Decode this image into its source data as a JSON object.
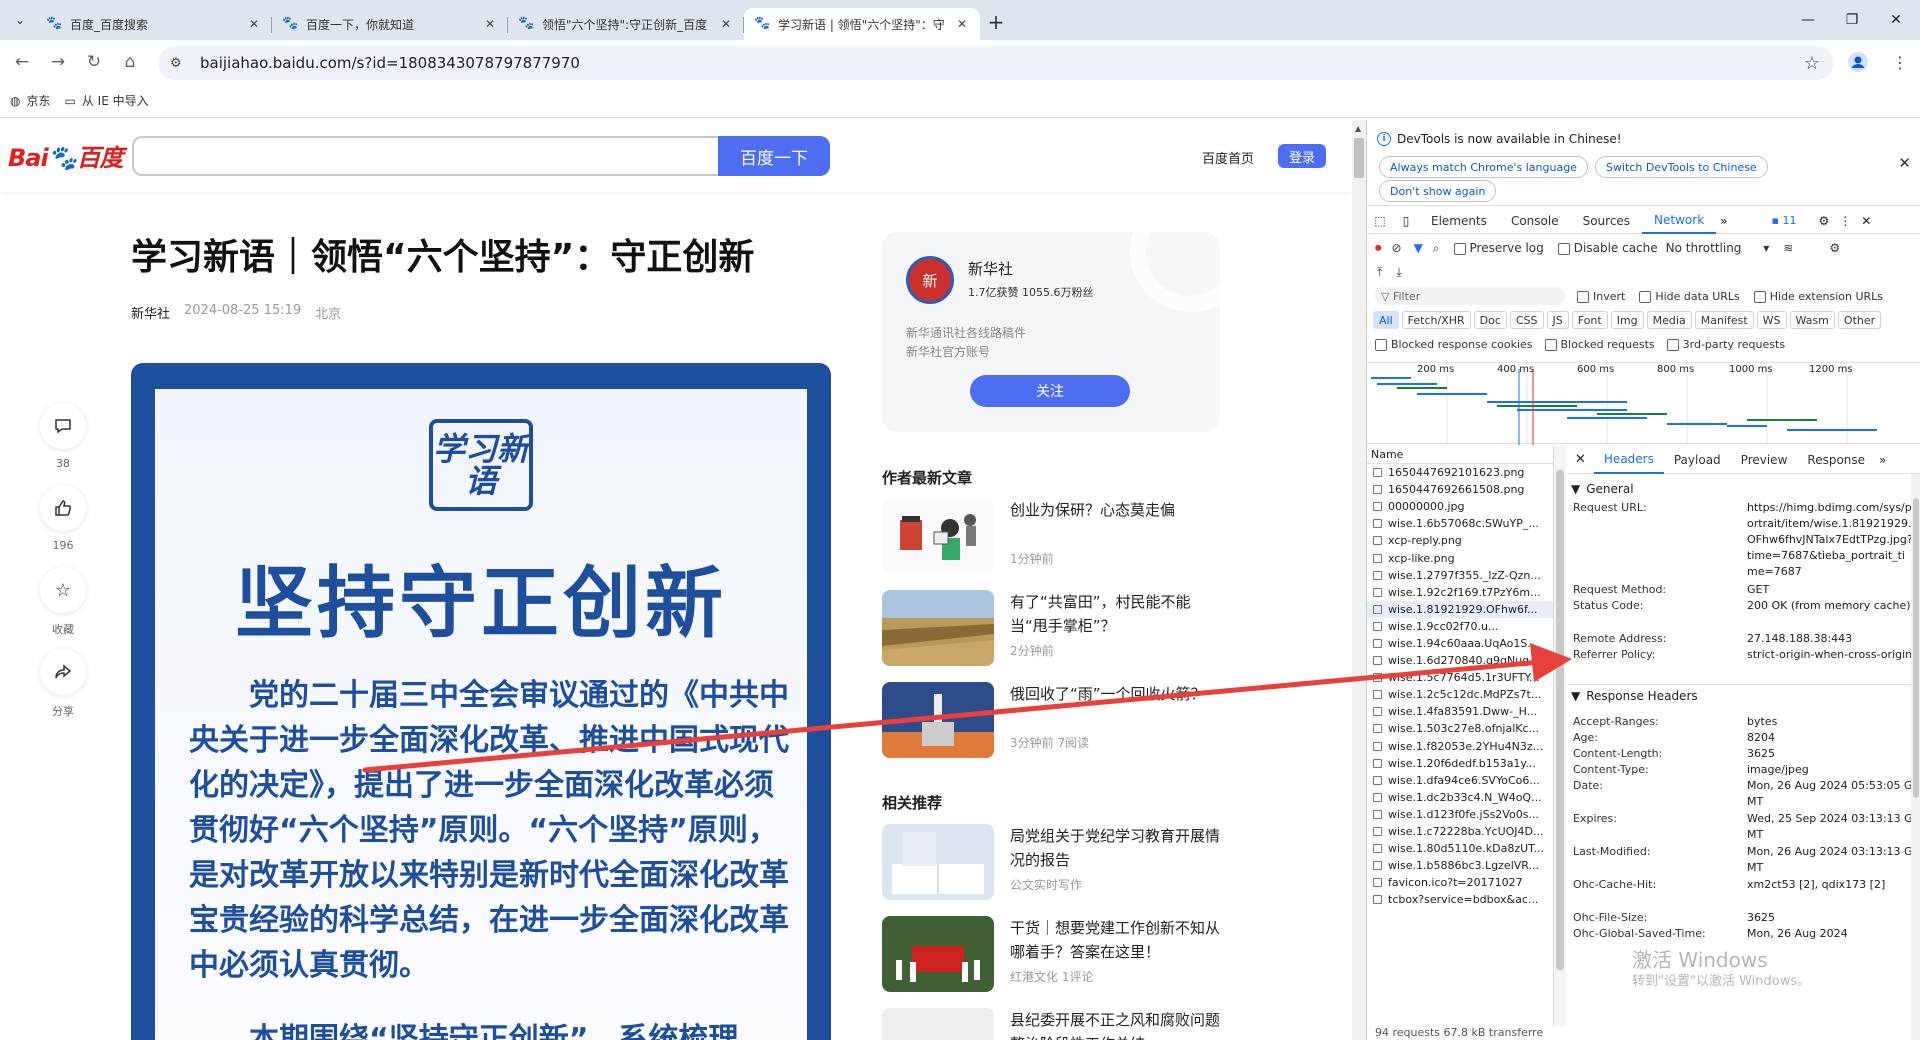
{
  "browser": {
    "tabs": [
      {
        "title": "百度_百度搜索"
      },
      {
        "title": "百度一下，你就知道"
      },
      {
        "title": "领悟\"六个坚持\":守正创新_百度"
      },
      {
        "title": "学习新语 | 领悟\"六个坚持\"：守"
      }
    ],
    "url": "baijiahao.baidu.com/s?id=1808343078797877970",
    "bookmarks": [
      "京东",
      "从 IE 中导入"
    ]
  },
  "baidu_header": {
    "logo_left": "Bai",
    "logo_paw": "du",
    "logo_right": "百度",
    "search_button": "百度一下",
    "home_link": "百度首页",
    "login": "登录"
  },
  "article": {
    "title": "学习新语｜领悟“六个坚持”：守正创新",
    "source": "新华社",
    "datetime": "2024-08-25 15:19",
    "location": "北京",
    "poster": {
      "logo_text": "学习新语",
      "headline": "坚持守正创新",
      "para1": "党的二十届三中全会审议通过的《中共中央关于进一步全面深化改革、推进中国式现代化的决定》，提出了进一步全面深化改革必须贯彻好“六个坚持”原则。“六个坚持”原则，是对改革开放以来特别是新时代全面深化改革宝贵经验的科学总结，在进一步全面深化改革中必须认真贯彻。",
      "para2": "本期围绕“坚持守正创新”，系统梳理"
    }
  },
  "side_actions": [
    {
      "icon": "comment-icon",
      "label": "38"
    },
    {
      "icon": "thumbs-up-icon",
      "label": "196"
    },
    {
      "icon": "star-icon",
      "label": "收藏"
    },
    {
      "icon": "share-icon",
      "label": "分享"
    }
  ],
  "author": {
    "name": "新华社",
    "stats": "1.7亿获赞 1055.6万粉丝",
    "desc1": "新华通讯社各线路稿件",
    "desc2": "新华社官方账号",
    "follow": "关注",
    "avatar_text": "新"
  },
  "latest": {
    "title": "作者最新文章",
    "items": [
      {
        "title": "创业为保研？心态莫走偏",
        "meta": "1分钟前"
      },
      {
        "title": "有了“共富田”，村民能不能当“甩手掌柜”？",
        "meta": "2分钟前"
      },
      {
        "title": "俄回收了“雨”一个回收火箭？",
        "meta": "3分钟前 7阅读"
      }
    ]
  },
  "related": {
    "title": "相关推荐",
    "items": [
      {
        "title": "局党组关于党纪学习教育开展情况的报告",
        "meta": "公文实时写作"
      },
      {
        "title": "干货｜想要党建工作创新不知从哪着手？答案在这里！",
        "meta": "红港文化 1评论"
      },
      {
        "title": "县纪委开展不正之风和腐败问题整治阶段性工作总结",
        "meta": ""
      }
    ]
  },
  "devtools": {
    "banner_text": "DevTools is now available in Chinese!",
    "btn_match": "Always match Chrome's language",
    "btn_switch": "Switch DevTools to Chinese",
    "btn_dont": "Don't show again",
    "tabs": [
      "Elements",
      "Console",
      "Sources",
      "Network"
    ],
    "issues_count": "11",
    "preserve_log": "Preserve log",
    "disable_cache": "Disable cache",
    "throttling": "No throttling",
    "filter_placeholder": "Filter",
    "invert": "Invert",
    "hide_data_urls": "Hide data URLs",
    "hide_ext_urls": "Hide extension URLs",
    "filter_types": [
      "All",
      "Fetch/XHR",
      "Doc",
      "CSS",
      "JS",
      "Font",
      "Img",
      "Media",
      "Manifest",
      "WS",
      "Wasm",
      "Other"
    ],
    "blocked_cookies": "Blocked response cookies",
    "blocked_requests": "Blocked requests",
    "third_party": "3rd-party requests",
    "timeline_ticks": [
      "200 ms",
      "400 ms",
      "600 ms",
      "800 ms",
      "1000 ms",
      "1200 ms"
    ],
    "name_col": "Name",
    "requests": [
      "1650447692101623.png",
      "1650447692661508.png",
      "00000000.jpg",
      "wise.1.6b57068c.SWuYP_...",
      "xcp-reply.png",
      "xcp-like.png",
      "wise.1.2797f355._lzZ-Qzn...",
      "wise.1.92c2f169.t7PzY6m...",
      "wise.1.81921929.OFhw6f...",
      "wise.1.9cc02f70.u...",
      "wise.1.94c60aaa.UqAo1S...",
      "wise.1.6d270840.q9gNuq...",
      "wise.1.5c7764d5.1r3UFTY...",
      "wise.1.2c5c12dc.MdPZs7t...",
      "wise.1.4fa83591.Dww-_H...",
      "wise.1.503c27e8.ofnjalKc...",
      "wise.1.f82053e.2YHu4N3z...",
      "wise.1.20f6dedf.b153a1y...",
      "wise.1.dfa94ce6.SVYoCo6...",
      "wise.1.dc2b33c4.N_W4oQ...",
      "wise.1.d123f0fe.jSs2Vo0s...",
      "wise.1.c72228ba.YcUOJ4D...",
      "wise.1.80d5110e.kDa8zUT...",
      "wise.1.b5886bc3.LgzelVR...",
      "favicon.ico?t=20171027",
      "tcbox?service=bdbox&ac..."
    ],
    "summary": "94 requests   67.8 kB transferre",
    "detail_tabs": [
      "Headers",
      "Payload",
      "Preview",
      "Response"
    ],
    "general_title": "General",
    "general": [
      {
        "k": "Request URL:",
        "v": "https://himg.bdimg.com/sys/portrait/item/wise.1.81921929.OFhw6fhvJNTalx7EdtTPzg.jpg?time=7687&tieba_portrait_time=7687"
      },
      {
        "k": "Request Method:",
        "v": "GET"
      },
      {
        "k": "Status Code:",
        "v": "200 OK (from memory cache)"
      },
      {
        "k": "Remote Address:",
        "v": "27.148.188.38:443"
      },
      {
        "k": "Referrer Policy:",
        "v": "strict-origin-when-cross-origin"
      }
    ],
    "response_title": "Response Headers",
    "response": [
      {
        "k": "Accept-Ranges:",
        "v": "bytes"
      },
      {
        "k": "Age:",
        "v": "8204"
      },
      {
        "k": "Content-Length:",
        "v": "3625"
      },
      {
        "k": "Content-Type:",
        "v": "image/jpeg"
      },
      {
        "k": "Date:",
        "v": "Mon, 26 Aug 2024 05:53:05 GMT"
      },
      {
        "k": "Expires:",
        "v": "Wed, 25 Sep 2024 03:13:13 GMT"
      },
      {
        "k": "Last-Modified:",
        "v": "Mon, 26 Aug 2024 03:13:13 GMT"
      },
      {
        "k": "Ohc-Cache-Hit:",
        "v": "xm2ct53 [2], qdix173 [2]"
      },
      {
        "k": "Ohc-File-Size:",
        "v": "3625"
      },
      {
        "k": "Ohc-Global-Saved-Time:",
        "v": "Mon, 26 Aug 2024"
      }
    ]
  },
  "watermark": {
    "line1": "激活 Windows",
    "line2": "转到\"设置\"以激活 Windows。"
  }
}
